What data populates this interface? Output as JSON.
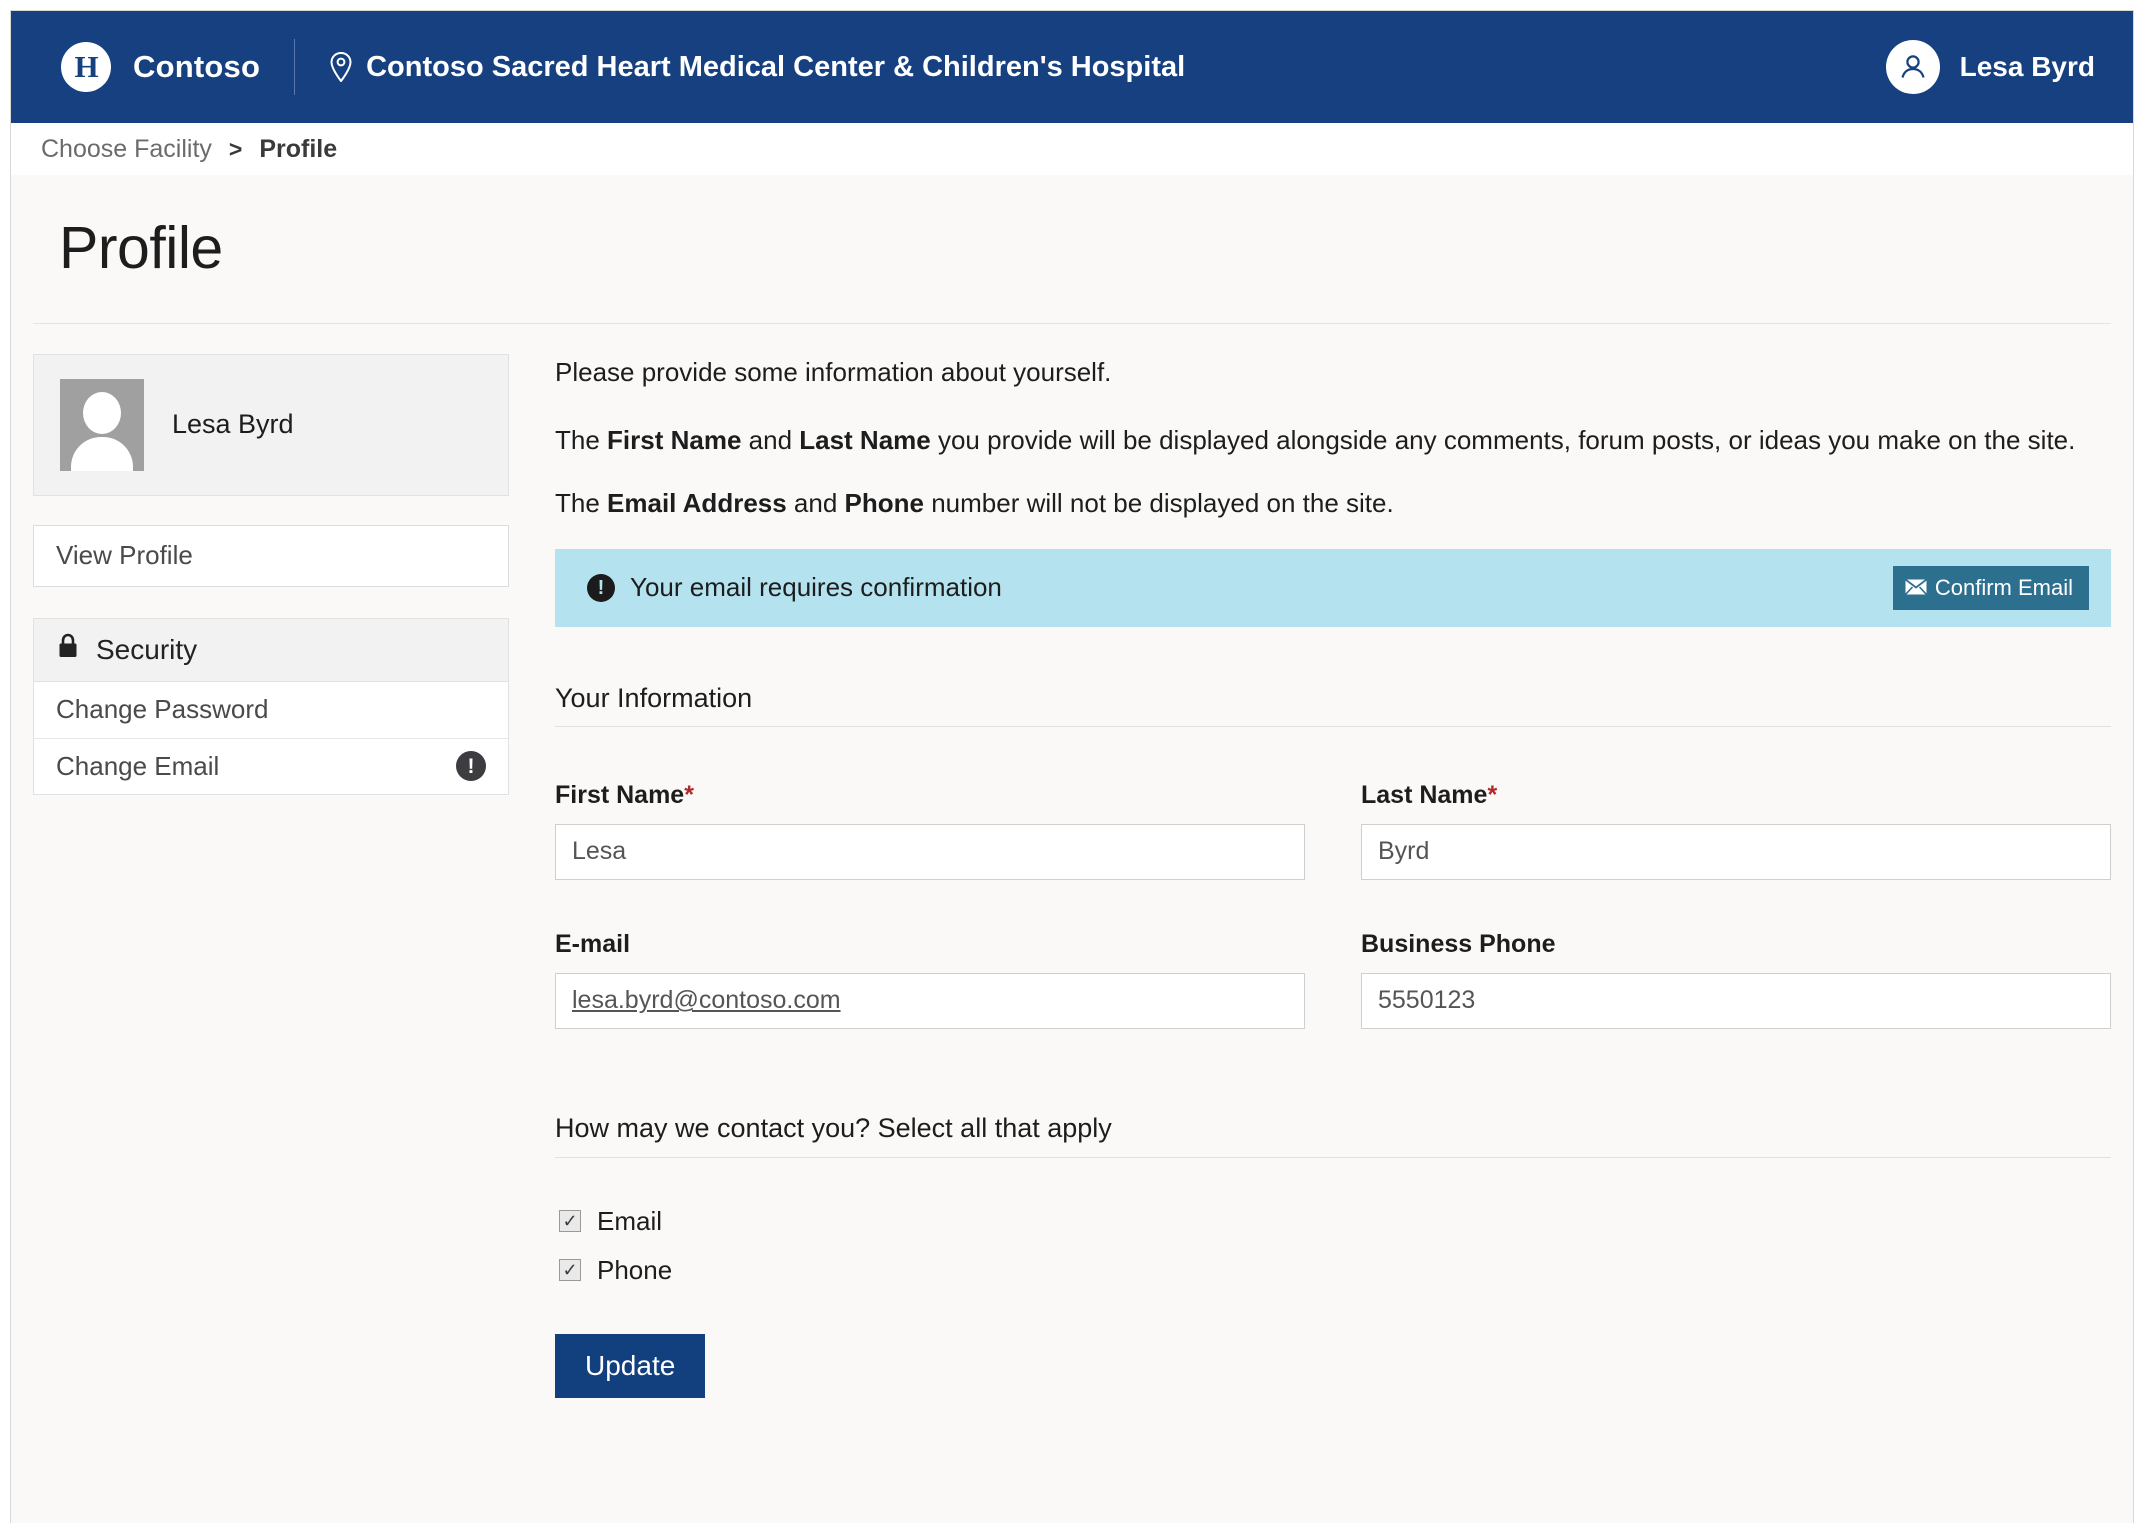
{
  "header": {
    "brand_initial": "H",
    "brand_name": "Contoso",
    "facility_name": "Contoso Sacred Heart Medical Center & Children's Hospital",
    "user_name": "Lesa Byrd",
    "pin_icon": "location-pin-icon",
    "avatar_icon": "user-avatar-icon",
    "background_color": "#16407f"
  },
  "breadcrumb": {
    "parent": "Choose Facility",
    "separator": ">",
    "current": "Profile"
  },
  "page": {
    "title": "Profile"
  },
  "sidebar": {
    "profile_card": {
      "name": "Lesa Byrd",
      "avatar_icon": "user-placeholder-icon"
    },
    "view_profile": "View Profile",
    "security": {
      "heading": "Security",
      "lock_icon": "lock-icon",
      "items": [
        {
          "label": "Change Password",
          "alert": false
        },
        {
          "label": "Change Email",
          "alert": true,
          "alert_icon": "exclamation-circle-icon"
        }
      ]
    }
  },
  "main": {
    "intro": {
      "line1": "Please provide some information about yourself.",
      "line2_pre": "The ",
      "line2_b1": "First Name",
      "line2_mid": " and ",
      "line2_b2": "Last Name",
      "line2_post": " you provide will be displayed alongside any comments, forum posts, or ideas you make on the site.",
      "line3_pre": "The ",
      "line3_b1": "Email Address",
      "line3_mid": " and ",
      "line3_b2": "Phone",
      "line3_post": " number will not be displayed on the site."
    },
    "banner": {
      "icon": "exclamation-circle-icon",
      "text": "Your email requires confirmation",
      "button_label": "Confirm Email",
      "button_icon": "envelope-icon",
      "background_color": "#b4e3ef",
      "button_color": "#2c6f8f"
    },
    "your_information_heading": "Your Information",
    "fields": {
      "first_name": {
        "label": "First Name",
        "required": "*",
        "value": "Lesa",
        "placeholder": "Lesa"
      },
      "last_name": {
        "label": "Last Name",
        "required": "*",
        "value": "Byrd",
        "placeholder": "Byrd"
      },
      "email": {
        "label": "E-mail",
        "value": "lesa.byrd@contoso.com"
      },
      "business_phone": {
        "label": "Business Phone",
        "value": "5550123",
        "placeholder": "5550123"
      }
    },
    "contact": {
      "heading": "How may we contact you? Select all that apply",
      "options": [
        {
          "label": "Email",
          "checked": true,
          "mark": "✓"
        },
        {
          "label": "Phone",
          "checked": true,
          "mark": "✓"
        }
      ]
    },
    "update_button": "Update",
    "update_button_color": "#123f7e"
  }
}
